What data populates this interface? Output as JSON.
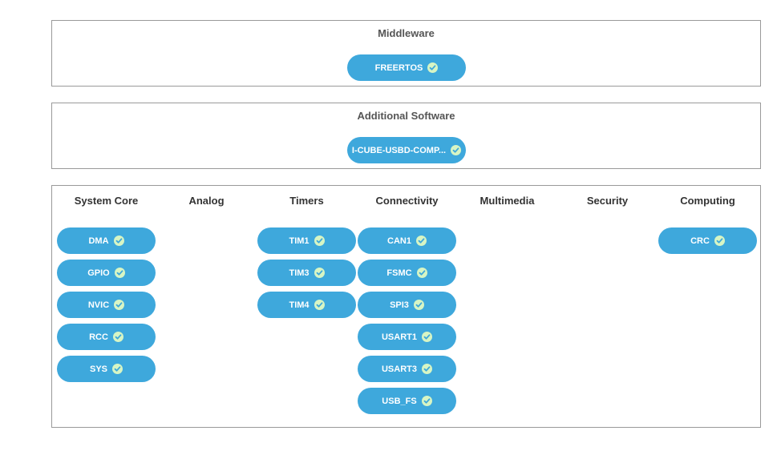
{
  "middleware": {
    "title": "Middleware",
    "items": [
      {
        "label": "FREERTOS",
        "status": "enabled"
      }
    ]
  },
  "additional_software": {
    "title": "Additional Software",
    "items": [
      {
        "label": "I-CUBE-USBD-COMP...",
        "status": "enabled"
      }
    ]
  },
  "categories": [
    {
      "title": "System Core",
      "items": [
        "DMA",
        "GPIO",
        "NVIC",
        "RCC",
        "SYS"
      ]
    },
    {
      "title": "Analog",
      "items": []
    },
    {
      "title": "Timers",
      "items": [
        "TIM1",
        "TIM3",
        "TIM4"
      ]
    },
    {
      "title": "Connectivity",
      "items": [
        "CAN1",
        "FSMC",
        "SPI3",
        "USART1",
        "USART3",
        "USB_FS"
      ]
    },
    {
      "title": "Multimedia",
      "items": []
    },
    {
      "title": "Security",
      "items": []
    },
    {
      "title": "Computing",
      "items": [
        "CRC"
      ]
    }
  ],
  "colors": {
    "pill": "#3ea8dc",
    "check_bg": "#d7f5c4",
    "check_mark": "#3ea8dc",
    "border": "#9a9a9a"
  },
  "icons": {
    "status": "check-circle-icon"
  }
}
